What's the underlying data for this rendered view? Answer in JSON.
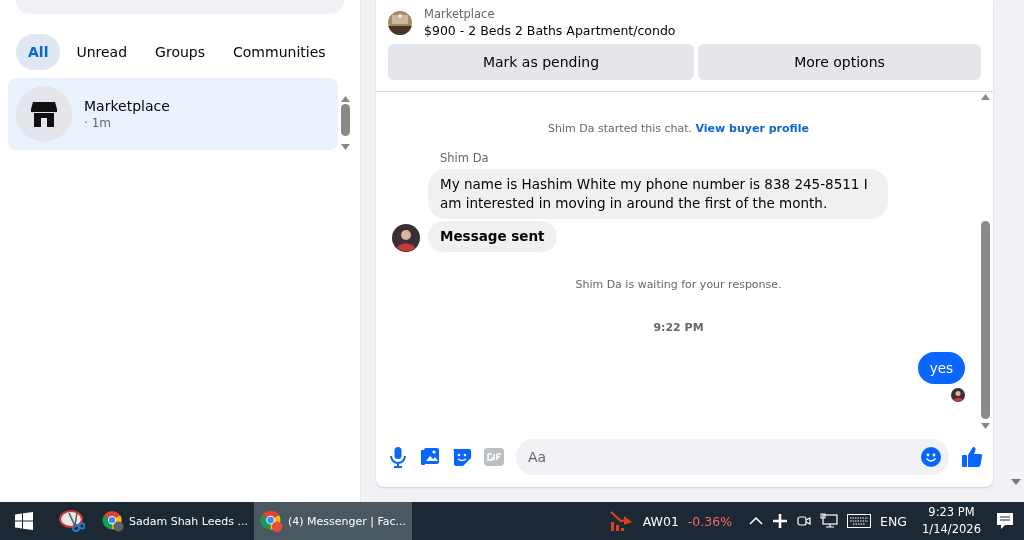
{
  "sidebar": {
    "filters": [
      {
        "label": "All",
        "selected": true
      },
      {
        "label": "Unread",
        "selected": false
      },
      {
        "label": "Groups",
        "selected": false
      },
      {
        "label": "Communities",
        "selected": false
      }
    ],
    "chats": [
      {
        "name": "Marketplace",
        "meta": "· 1m",
        "selected": true
      }
    ]
  },
  "listing": {
    "source": "Marketplace",
    "title": "$900 - 2 Beds 2 Baths Apartment/condo",
    "buttons": [
      "Mark as pending",
      "More options"
    ]
  },
  "messages": [
    {
      "kind": "system",
      "text": "Shim Da started this chat.",
      "link": "View buyer profile"
    },
    {
      "kind": "sender",
      "text": "Shim Da"
    },
    {
      "kind": "incoming",
      "text": "My name is Hashim White my phone number is 838 245-8511 I am interested in moving in around the first of the month.",
      "avatar": false
    },
    {
      "kind": "incoming",
      "text": "**Message sent**",
      "avatar": true
    },
    {
      "kind": "system",
      "text": "Shim Da is waiting for your response."
    },
    {
      "kind": "time",
      "text": "9:22 PM"
    },
    {
      "kind": "outgoing",
      "text": "yes",
      "seen": true
    }
  ],
  "composer": {
    "placeholder": "Aa"
  },
  "taskbar": {
    "apps": [
      {
        "label": "Sadam Shah Leeds ...",
        "selected": false
      },
      {
        "label": "(4) Messenger | Fac...",
        "selected": true
      }
    ],
    "ticker": {
      "symbol": "AW01",
      "change": "-0.36%"
    },
    "language": "ENG",
    "time": "9:23 PM",
    "date": "1/14/2026"
  }
}
